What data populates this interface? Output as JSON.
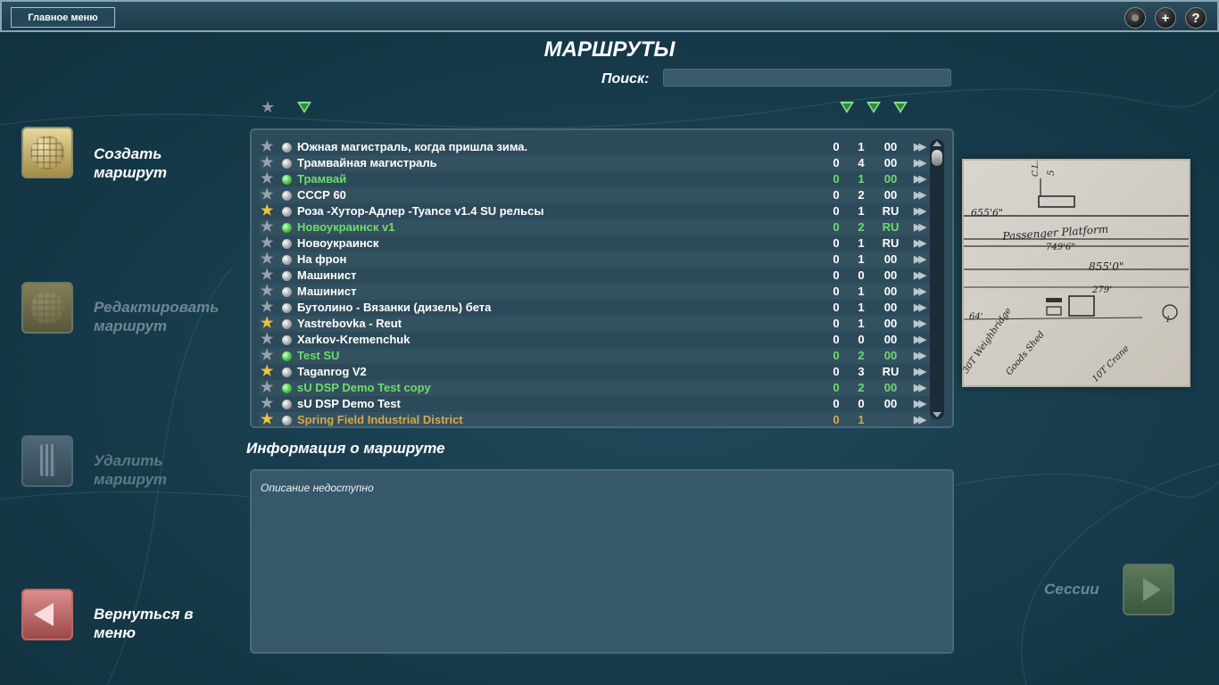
{
  "header": {
    "main_menu": "Главное меню",
    "icons": [
      "record-icon",
      "plus-icon",
      "help-icon"
    ],
    "plus_glyph": "+",
    "help_glyph": "?"
  },
  "page": {
    "title": "МАРШРУТЫ",
    "search_label": "Поиск:",
    "search_value": "",
    "search_placeholder": ""
  },
  "routes": [
    {
      "name": "Южная магистраль, когда пришла зима.",
      "fav": false,
      "green": false,
      "c1": "0",
      "c2": "1",
      "c3": "00"
    },
    {
      "name": "Трамвайная магистраль",
      "fav": false,
      "green": false,
      "c1": "0",
      "c2": "4",
      "c3": "00"
    },
    {
      "name": "Трамвай",
      "fav": false,
      "green": true,
      "c1": "0",
      "c2": "1",
      "c3": "00"
    },
    {
      "name": "СССР 60",
      "fav": false,
      "green": false,
      "c1": "0",
      "c2": "2",
      "c3": "00"
    },
    {
      "name": "Роза -Хутор-Адлер -Tyance v1.4 SU рельсы",
      "fav": true,
      "green": false,
      "c1": "0",
      "c2": "1",
      "c3": "RU"
    },
    {
      "name": "Новоукраинск v1",
      "fav": false,
      "green": true,
      "c1": "0",
      "c2": "2",
      "c3": "RU"
    },
    {
      "name": "Новоукраинск",
      "fav": false,
      "green": false,
      "c1": "0",
      "c2": "1",
      "c3": "RU"
    },
    {
      "name": "На фрон",
      "fav": false,
      "green": false,
      "c1": "0",
      "c2": "1",
      "c3": "00"
    },
    {
      "name": "Машинист",
      "fav": false,
      "green": false,
      "c1": "0",
      "c2": "0",
      "c3": "00"
    },
    {
      "name": "Машинист",
      "fav": false,
      "green": false,
      "c1": "0",
      "c2": "1",
      "c3": "00"
    },
    {
      "name": "Бутолино - Вязанки (дизель) бета",
      "fav": false,
      "green": false,
      "c1": "0",
      "c2": "1",
      "c3": "00"
    },
    {
      "name": "Yastrebovka - Reut",
      "fav": true,
      "green": false,
      "c1": "0",
      "c2": "1",
      "c3": "00"
    },
    {
      "name": "Xarkov-Kremenchuk",
      "fav": false,
      "green": false,
      "c1": "0",
      "c2": "0",
      "c3": "00"
    },
    {
      "name": "Test SU",
      "fav": false,
      "green": true,
      "c1": "0",
      "c2": "2",
      "c3": "00"
    },
    {
      "name": "Taganrog V2",
      "fav": true,
      "green": false,
      "c1": "0",
      "c2": "3",
      "c3": "RU"
    },
    {
      "name": "sU DSP Demo Test copy",
      "fav": false,
      "green": true,
      "c1": "0",
      "c2": "2",
      "c3": "00"
    },
    {
      "name": "sU DSP Demo Test",
      "fav": false,
      "green": false,
      "c1": "0",
      "c2": "0",
      "c3": "00"
    },
    {
      "name": "Spring Field Industrial District",
      "fav": true,
      "green": false,
      "c1": "0",
      "c2": "1",
      "c3": "",
      "cut": true
    }
  ],
  "info": {
    "title": "Информация о маршруте",
    "description": "Описание недоступно"
  },
  "actions": {
    "create": "Создать маршрут",
    "edit": "Редактировать маршрут",
    "delete": "Удалить маршрут",
    "back": "Вернуться в меню",
    "sessions": "Сессии"
  },
  "preview": {
    "labels": [
      "655'6\"",
      "Passenger Platform",
      "749'6\"",
      "855'0\"",
      "279'",
      "64'",
      "30T Weighbridge",
      "Goods Shed",
      "10T Crane",
      "1",
      "C.L.",
      "5"
    ]
  },
  "colors": {
    "accent_green": "#6fdc6a",
    "favorite_star": "#f2c23a",
    "background": "#183d4d"
  }
}
